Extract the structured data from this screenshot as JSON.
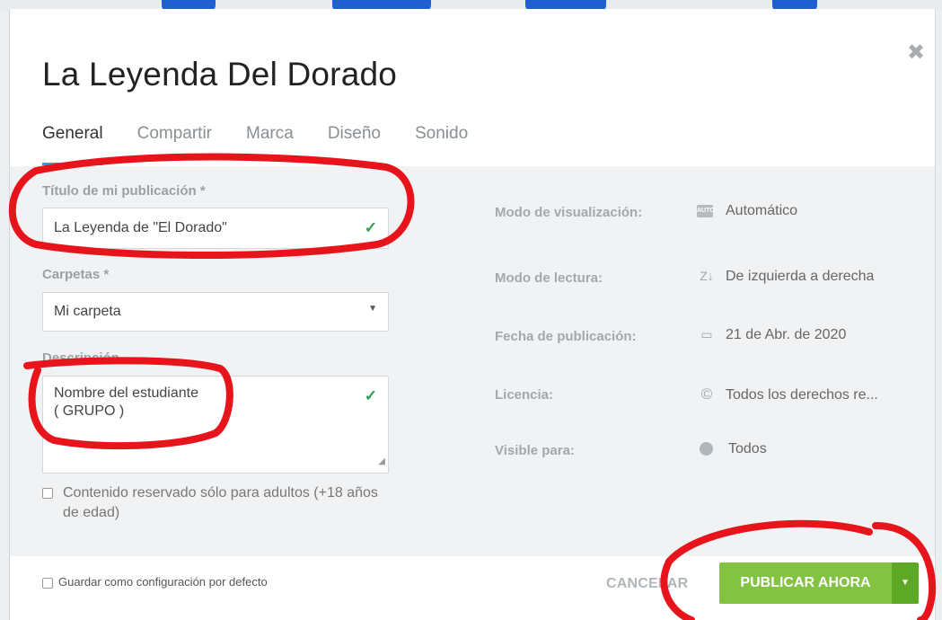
{
  "dialog": {
    "title": "La Leyenda Del Dorado",
    "close_glyph": "✖"
  },
  "tabs": [
    {
      "label": "General",
      "active": true
    },
    {
      "label": "Compartir",
      "active": false
    },
    {
      "label": "Marca",
      "active": false
    },
    {
      "label": "Diseño",
      "active": false
    },
    {
      "label": "Sonido",
      "active": false
    }
  ],
  "form": {
    "title_label": "Título de mi publicación *",
    "title_value": "La Leyenda de \"El Dorado\"",
    "folders_label": "Carpetas *",
    "folders_value": "Mi carpeta",
    "description_label": "Descripción",
    "description_value": "Nombre del estudiante\n( GRUPO )",
    "adult_label": "Contenido reservado sólo para adultos (+18 años de edad)"
  },
  "details": [
    {
      "label": "Modo de visualización:",
      "value": "Automático",
      "icon": "auto-icon"
    },
    {
      "label": "Modo de lectura:",
      "value": "De izquierda a derecha",
      "icon": "reading-direction-icon"
    },
    {
      "label": "Fecha de publicación:",
      "value": "21 de Abr. de 2020",
      "icon": "calendar-icon"
    },
    {
      "label": "Licencia:",
      "value": "Todos los derechos re...",
      "icon": "copyright-icon"
    },
    {
      "label": "Visible para:",
      "value": "Todos",
      "icon": "globe-icon"
    }
  ],
  "icons": {
    "auto_badge": "AUTO",
    "reading": "Z↓",
    "calendar": "▭",
    "copyright": "©"
  },
  "footer": {
    "default_label": "Guardar como configuración por defecto",
    "cancel_label": "CANCELAR",
    "publish_label": "PUBLICAR AHORA"
  },
  "colors": {
    "accent_tab": "#2f9ee6",
    "publish_green": "#83c242",
    "publish_dropdown": "#5da824",
    "check_green": "#2e9e4e",
    "annotation_red": "#e8141b"
  }
}
